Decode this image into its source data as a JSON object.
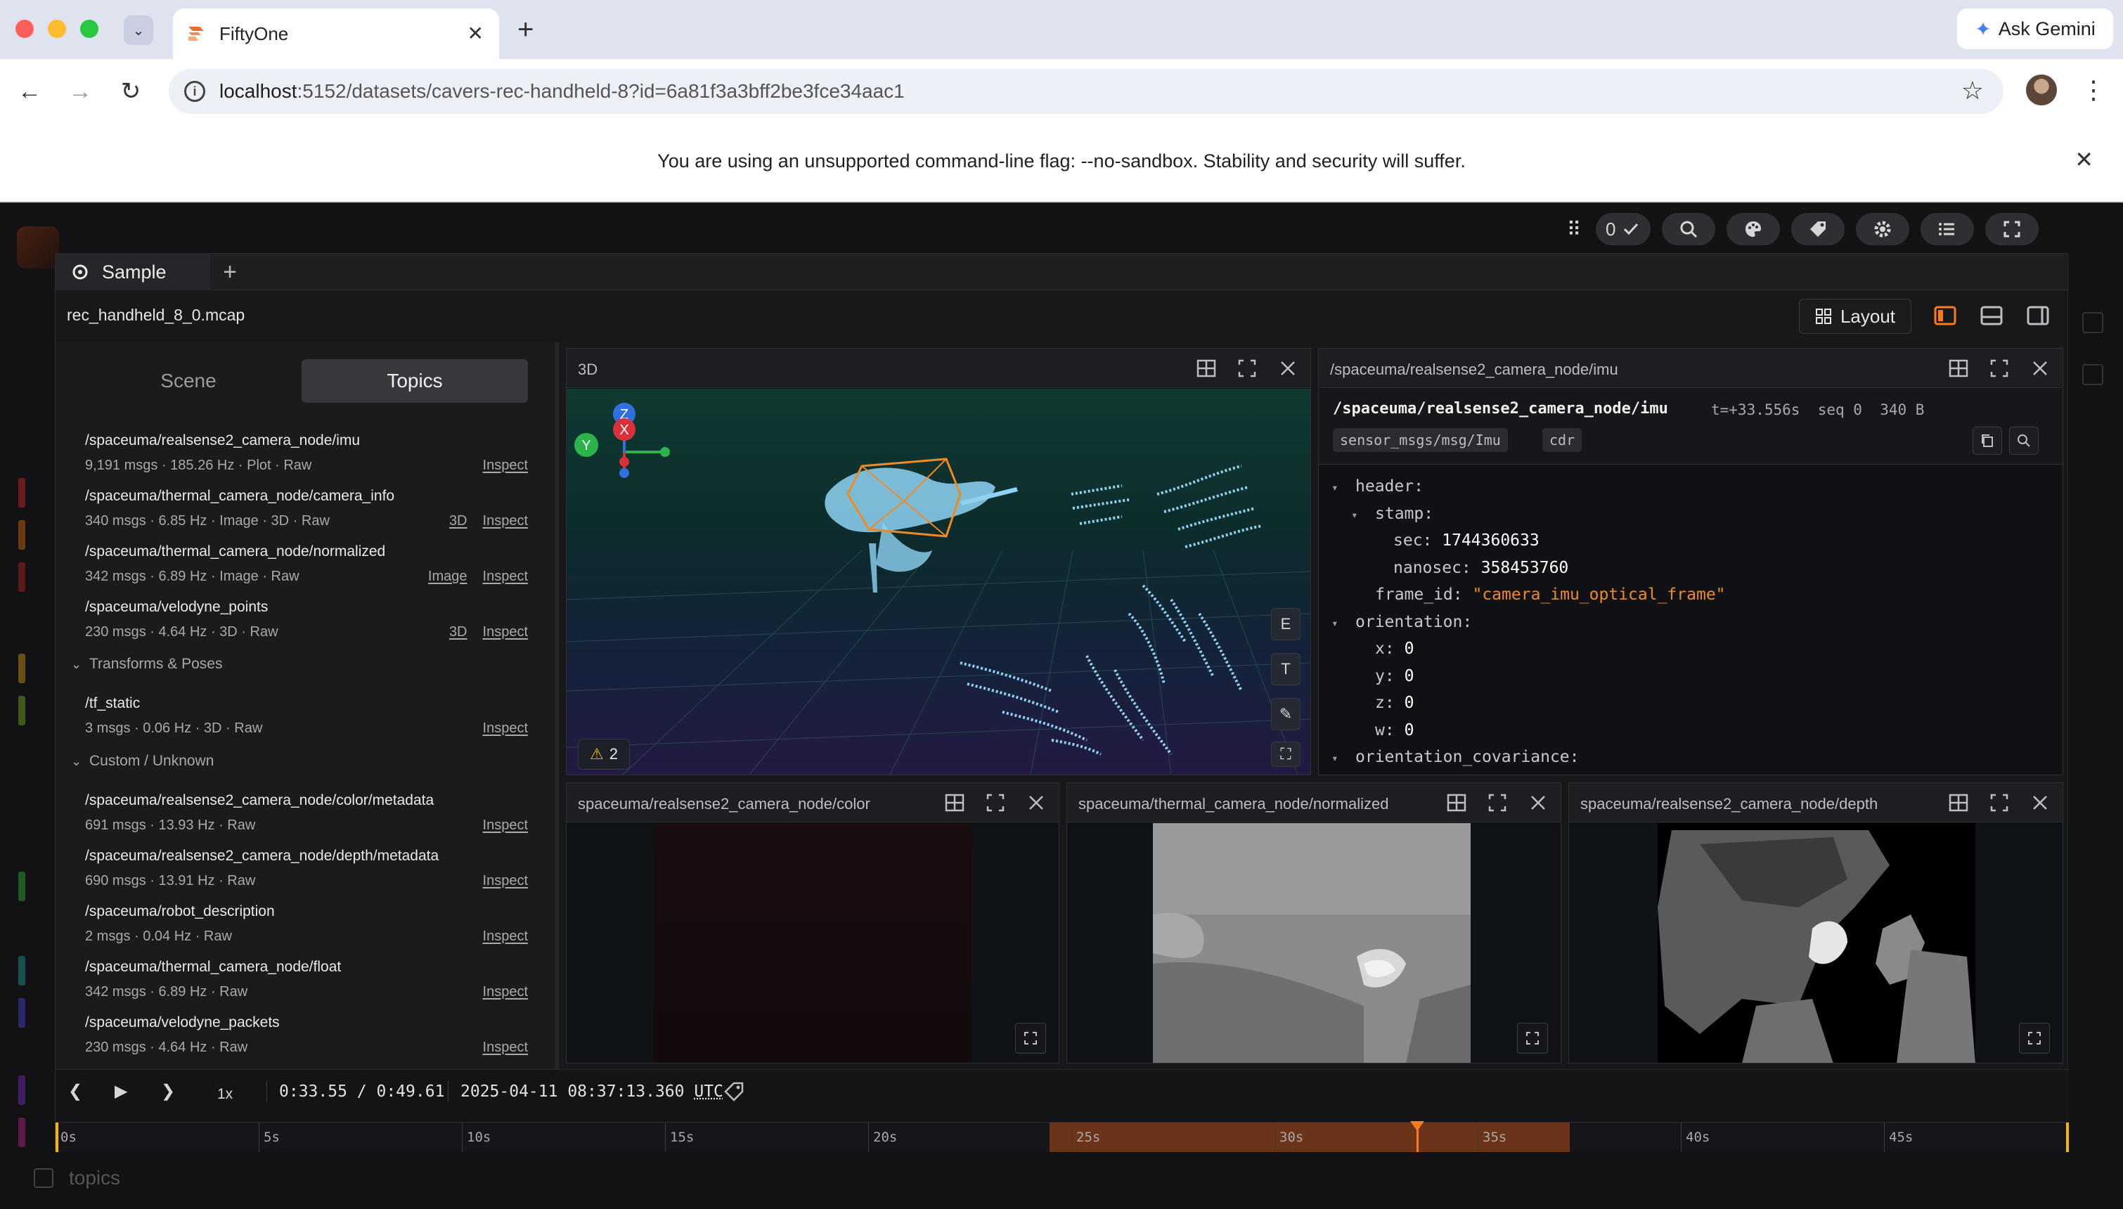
{
  "browser": {
    "tab_title": "FiftyOne",
    "url_host": "localhost",
    "url_rest": ":5152/datasets/cavers-rec-handheld-8?id=6a81f3a3bff2be3fce34aac1",
    "ask_gemini": "Ask Gemini",
    "infobar_message": "You are using an unsupported command-line flag: --no-sandbox. Stability and security will suffer."
  },
  "background": {
    "topics_label": "topics"
  },
  "top_controls": {
    "check_count": "0"
  },
  "modal": {
    "tab_label": "Sample",
    "filename": "rec_handheld_8_0.mcap",
    "layout_label": "Layout"
  },
  "left_panel": {
    "tabs": [
      "Scene",
      "Topics"
    ],
    "active_tab": "Topics",
    "topics_main": [
      {
        "name": "/spaceuma/realsense2_camera_node/imu",
        "meta": "9,191 msgs · 185.26 Hz · Plot · Raw",
        "actions": [
          "Inspect"
        ]
      },
      {
        "name": "/spaceuma/thermal_camera_node/camera_info",
        "meta": "340 msgs · 6.85 Hz · Image · 3D · Raw",
        "actions": [
          "3D",
          "Inspect"
        ]
      },
      {
        "name": "/spaceuma/thermal_camera_node/normalized",
        "meta": "342 msgs · 6.89 Hz · Image · Raw",
        "actions": [
          "Image",
          "Inspect"
        ]
      },
      {
        "name": "/spaceuma/velodyne_points",
        "meta": "230 msgs · 4.64 Hz · 3D · Raw",
        "actions": [
          "3D",
          "Inspect"
        ]
      }
    ],
    "group_transforms": "Transforms & Poses",
    "topics_transforms": [
      {
        "name": "/tf_static",
        "meta": "3 msgs · 0.06 Hz · 3D · Raw",
        "actions": [
          "Inspect"
        ]
      }
    ],
    "group_custom": "Custom / Unknown",
    "topics_custom": [
      {
        "name": "/spaceuma/realsense2_camera_node/color/metadata",
        "meta": "691 msgs · 13.93 Hz · Raw",
        "actions": [
          "Inspect"
        ]
      },
      {
        "name": "/spaceuma/realsense2_camera_node/depth/metadata",
        "meta": "690 msgs · 13.91 Hz · Raw",
        "actions": [
          "Inspect"
        ]
      },
      {
        "name": "/spaceuma/robot_description",
        "meta": "2 msgs · 0.04 Hz · Raw",
        "actions": [
          "Inspect"
        ]
      },
      {
        "name": "/spaceuma/thermal_camera_node/float",
        "meta": "342 msgs · 6.89 Hz · Raw",
        "actions": [
          "Inspect"
        ]
      },
      {
        "name": "/spaceuma/velodyne_packets",
        "meta": "230 msgs · 4.64 Hz · Raw",
        "actions": [
          "Inspect"
        ]
      }
    ]
  },
  "panels": {
    "three_d": {
      "title": "3D",
      "side_buttons": [
        "E",
        "T"
      ],
      "warning_count": "2",
      "axis_labels": {
        "z": "Z",
        "x": "X",
        "y": "Y"
      }
    },
    "imu": {
      "title": "/spaceuma/realsense2_camera_node/imu",
      "path": "/spaceuma/realsense2_camera_node/imu",
      "stats": "t=+33.556s  seq 0  340 B",
      "chips": [
        "sensor_msgs/msg/Imu",
        "cdr"
      ],
      "tree": {
        "header": "header:",
        "stamp": "stamp:",
        "sec_key": "sec:",
        "sec_val": "1744360633",
        "nanosec_key": "nanosec:",
        "nanosec_val": "358453760",
        "frame_id_key": "frame_id:",
        "frame_id_val": "\"camera_imu_optical_frame\"",
        "orientation": "orientation:",
        "x_key": "x:",
        "x_val": "0",
        "y_key": "y:",
        "y_val": "0",
        "z_key": "z:",
        "z_val": "0",
        "w_key": "w:",
        "w_val": "0",
        "orientation_cov": "orientation_covariance:"
      }
    },
    "color": {
      "title": "spaceuma/realsense2_camera_node/color"
    },
    "thermal": {
      "title": "spaceuma/thermal_camera_node/normalized"
    },
    "depth": {
      "title": "spaceuma/realsense2_camera_node/depth"
    }
  },
  "player": {
    "speed": "1x",
    "current": "0:33.55",
    "duration": "0:49.61",
    "separator": " / ",
    "datetime": "2025-04-11 08:37:13.360",
    "tz": "UTC",
    "ticks": [
      "0s",
      "5s",
      "10s",
      "15s",
      "20s",
      "25s",
      "30s",
      "35s",
      "40s",
      "45s"
    ]
  }
}
